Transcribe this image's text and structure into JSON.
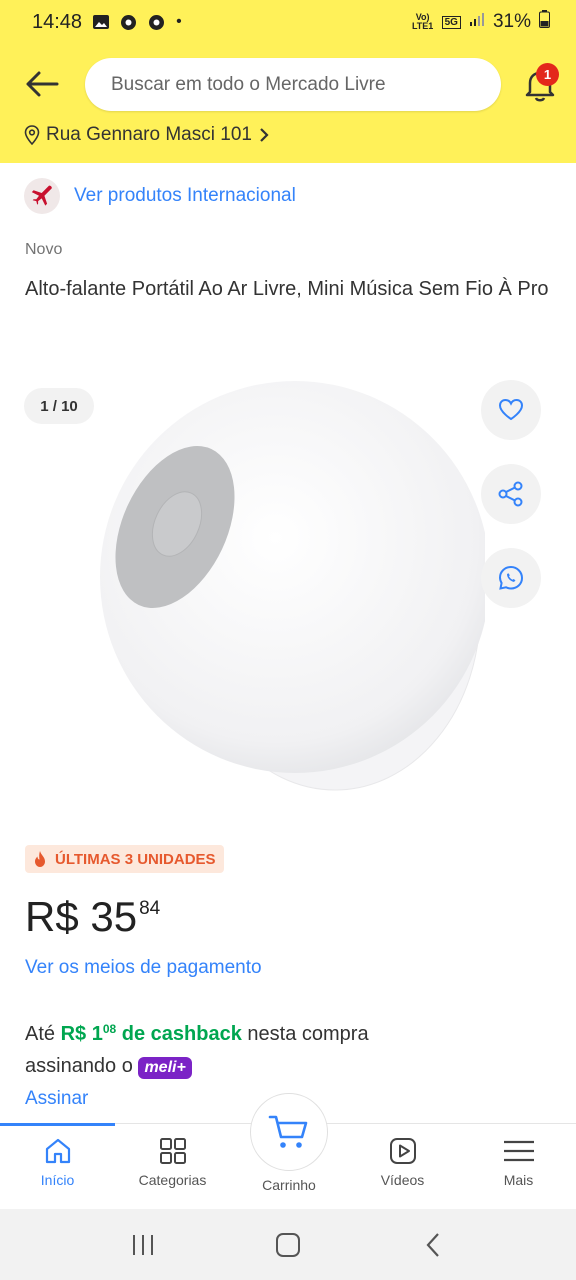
{
  "status_bar": {
    "time": "14:48",
    "dot": "•",
    "network": "5G",
    "volte": "Vo) LTE1",
    "battery": "31%"
  },
  "header": {
    "search_placeholder": "Buscar em todo o Mercado Livre",
    "notifications_count": "1",
    "address": "Rua Gennaro Masci 101"
  },
  "product": {
    "international_link": "Ver produtos Internacional",
    "condition": "Novo",
    "title": "Alto-falante Portátil Ao Ar Livre, Mini Música Sem Fio À Pro",
    "image_counter": "1 / 10",
    "stock_label": "ÚLTIMAS 3 UNIDADES",
    "price_currency_int": "R$ 35",
    "price_cents": "84",
    "payments_link": "Ver os meios de pagamento",
    "cashback": {
      "prefix": "Até",
      "amount_int": "R$ 1",
      "amount_cents": "08",
      "highlight": "de cashback",
      "suffix": "nesta compra",
      "line2": "assinando o",
      "badge": "meli+"
    },
    "subscribe_link": "Assinar"
  },
  "bottom_nav": {
    "items": [
      {
        "label": "Início",
        "icon": "home-icon",
        "active": true
      },
      {
        "label": "Categorias",
        "icon": "grid-icon",
        "active": false
      },
      {
        "label": "Carrinho",
        "icon": "cart-icon",
        "active": false
      },
      {
        "label": "Vídeos",
        "icon": "play-icon",
        "active": false
      },
      {
        "label": "Mais",
        "icon": "menu-icon",
        "active": false
      }
    ]
  },
  "colors": {
    "header_yellow": "#fff159",
    "link_blue": "#3483fa",
    "cashback_green": "#00a650",
    "stock_orange": "#e6592e",
    "meli_purple": "#7b23c6",
    "badge_red": "#e3281b"
  }
}
